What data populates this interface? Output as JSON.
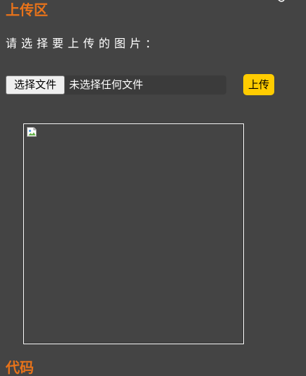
{
  "upload_section": {
    "title": "上传区",
    "prompt": "请选择要上传的图片：",
    "file_input": {
      "button_label": "选择文件",
      "status_text": "未选择任何文件"
    },
    "upload_button_label": "上传",
    "preview_image": {
      "icon": "broken-image-icon"
    }
  },
  "next_section": {
    "title": "代码"
  },
  "colors": {
    "background": "#444444",
    "section_title": "#e8731a",
    "upload_button": "#ffcc00",
    "text": "#ffffff"
  }
}
